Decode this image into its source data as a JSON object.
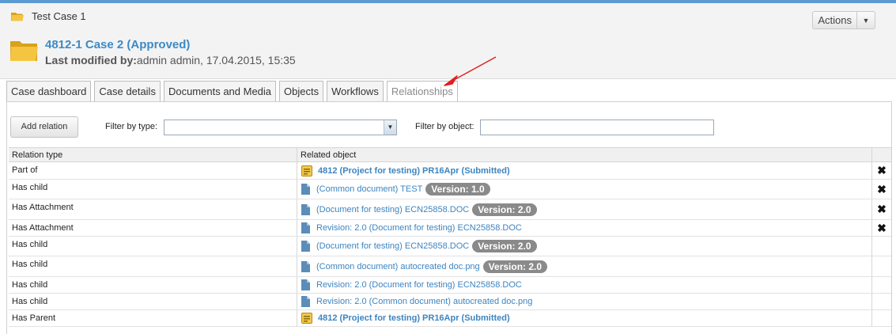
{
  "breadcrumb": "Test Case 1",
  "actions_label": "Actions",
  "case": {
    "title": "4812-1 Case 2 (Approved)",
    "last_modified_label": "Last modified by:",
    "last_modified_value": "admin admin, 17.04.2015, 15:35"
  },
  "tabs": [
    {
      "label": "Case dashboard"
    },
    {
      "label": "Case details"
    },
    {
      "label": "Documents and Media"
    },
    {
      "label": "Objects"
    },
    {
      "label": "Workflows"
    },
    {
      "label": "Relationships",
      "active": true
    }
  ],
  "toolbar": {
    "add_label": "Add relation",
    "filter_type_label": "Filter by type:",
    "filter_type_value": "",
    "filter_object_label": "Filter by object:",
    "filter_object_value": ""
  },
  "table": {
    "headers": [
      "Relation type",
      "Related object"
    ],
    "rows": [
      {
        "type": "Part of",
        "icon": "project-icon",
        "object": "4812 (Project for testing) PR16Apr (Submitted)",
        "bold": true,
        "version": "",
        "deletable": true
      },
      {
        "type": "Has child",
        "icon": "document-icon",
        "object": "(Common document) TEST",
        "bold": false,
        "version": "Version: 1.0",
        "deletable": true
      },
      {
        "type": "Has Attachment",
        "icon": "document-icon",
        "object": "(Document for testing) ECN25858.DOC",
        "bold": false,
        "version": "Version: 2.0",
        "deletable": true
      },
      {
        "type": "Has Attachment",
        "icon": "document-icon",
        "object": "Revision: 2.0 (Document for testing) ECN25858.DOC",
        "bold": false,
        "version": "",
        "deletable": true
      },
      {
        "type": "Has child",
        "icon": "document-icon",
        "object": "(Document for testing) ECN25858.DOC",
        "bold": false,
        "version": "Version: 2.0",
        "deletable": false
      },
      {
        "type": "Has child",
        "icon": "document-icon",
        "object": "(Common document) autocreated doc.png",
        "bold": false,
        "version": "Version: 2.0",
        "deletable": false
      },
      {
        "type": "Has child",
        "icon": "document-icon",
        "object": "Revision: 2.0 (Document for testing) ECN25858.DOC",
        "bold": false,
        "version": "",
        "deletable": false
      },
      {
        "type": "Has child",
        "icon": "document-icon",
        "object": "Revision: 2.0 (Common document) autocreated doc.png",
        "bold": false,
        "version": "",
        "deletable": false
      },
      {
        "type": "Has Parent",
        "icon": "project-icon",
        "object": "4812 (Project for testing) PR16Apr (Submitted)",
        "bold": true,
        "version": "",
        "deletable": false
      }
    ]
  },
  "delete_glyph": "✖",
  "colors": {
    "accent": "#3d84c0",
    "badge": "#8a8a8a",
    "arrow": "#e02020"
  }
}
